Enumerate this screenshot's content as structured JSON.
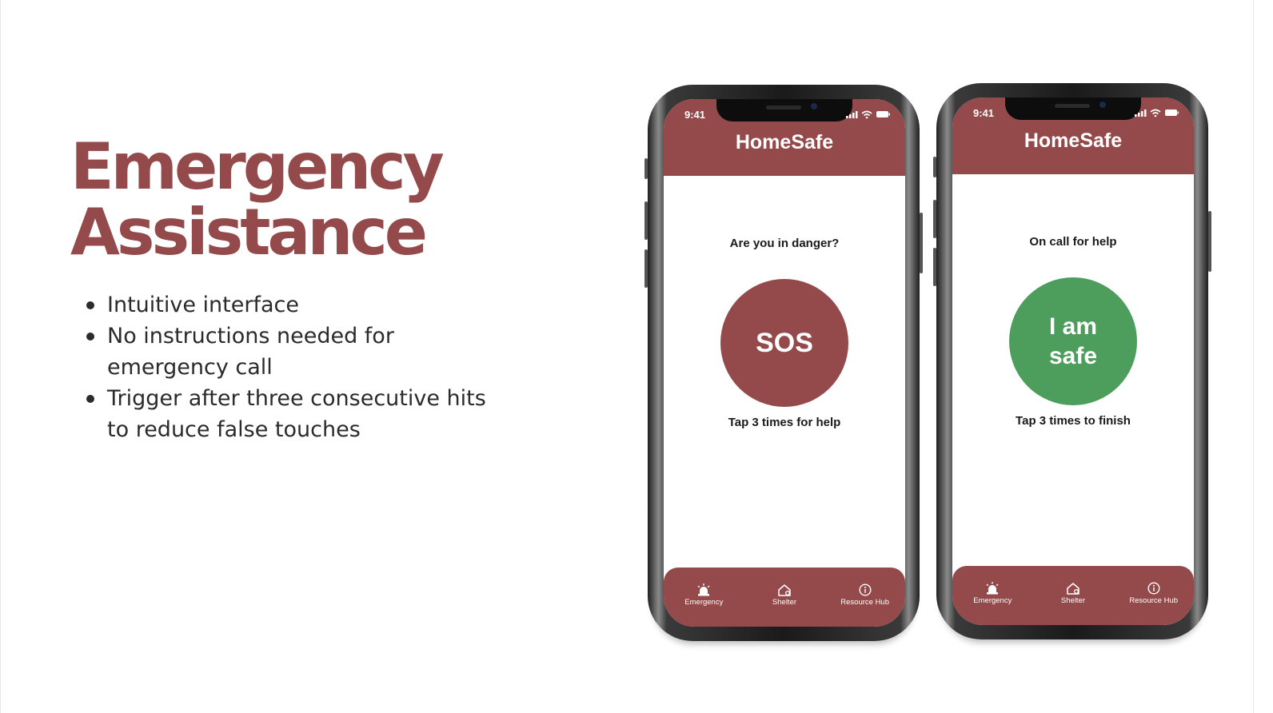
{
  "slide": {
    "title_line1": "Emergency",
    "title_line2": "Assistance",
    "bullets": [
      "Intuitive interface",
      "No instructions needed for emergency call",
      "Trigger after three consecutive hits to reduce false touches"
    ]
  },
  "colors": {
    "brand": "#944a4a",
    "safe_green": "#4d9d5c",
    "text_dark": "#2b2b2b"
  },
  "phones": [
    {
      "status_time": "9:41",
      "app_title": "HomeSafe",
      "prompt": "Are you in danger?",
      "button_label": "SOS",
      "hint": "Tap 3 times for help",
      "tabs": [
        {
          "label": "Emergency",
          "icon": "alarm-bell-icon"
        },
        {
          "label": "Shelter",
          "icon": "home-icon"
        },
        {
          "label": "Resource Hub",
          "icon": "info-icon"
        }
      ]
    },
    {
      "status_time": "9:41",
      "app_title": "HomeSafe",
      "prompt": "On call for help",
      "button_line1": "I am",
      "button_line2": "safe",
      "hint": "Tap 3 times to finish",
      "tabs": [
        {
          "label": "Emergency",
          "icon": "alarm-bell-icon"
        },
        {
          "label": "Shelter",
          "icon": "home-icon"
        },
        {
          "label": "Resource Hub",
          "icon": "info-icon"
        }
      ]
    }
  ]
}
